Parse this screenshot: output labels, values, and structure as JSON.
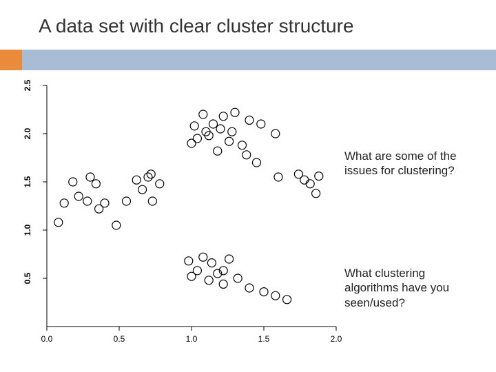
{
  "title": "A data set with clear cluster structure",
  "accent": {
    "left": "#e98b3a",
    "right": "#a9bcd6"
  },
  "callouts": {
    "q1": "What are some of the issues for clustering?",
    "q2": "What clustering algorithms have you seen/used?"
  },
  "chart_data": {
    "type": "scatter",
    "title": "",
    "xlabel": "",
    "ylabel": "",
    "xlim": [
      0.0,
      2.0
    ],
    "ylim": [
      0.0,
      2.5
    ],
    "xticks": [
      0.0,
      0.5,
      1.0,
      1.5,
      2.0
    ],
    "yticks": [
      0.5,
      1.0,
      1.5,
      2.0,
      2.5
    ],
    "series": [
      {
        "name": "points",
        "marker": "open-circle",
        "x": [
          0.08,
          0.12,
          0.18,
          0.22,
          0.28,
          0.3,
          0.34,
          0.36,
          0.4,
          0.48,
          0.55,
          0.62,
          0.66,
          0.7,
          0.72,
          0.73,
          0.78,
          1.0,
          1.02,
          1.04,
          1.08,
          1.1,
          1.12,
          1.15,
          1.18,
          1.2,
          1.22,
          1.26,
          1.28,
          1.3,
          1.35,
          1.38,
          1.4,
          1.45,
          1.48,
          1.58,
          0.98,
          1.0,
          1.04,
          1.08,
          1.12,
          1.14,
          1.18,
          1.22,
          1.22,
          1.26,
          1.32,
          1.4,
          1.5,
          1.58,
          1.66,
          1.74,
          1.78,
          1.82,
          1.86,
          1.88,
          1.6
        ],
        "y": [
          1.08,
          1.28,
          1.5,
          1.35,
          1.3,
          1.55,
          1.48,
          1.22,
          1.28,
          1.05,
          1.3,
          1.52,
          1.42,
          1.55,
          1.58,
          1.3,
          1.48,
          1.9,
          2.08,
          1.95,
          2.2,
          2.02,
          1.98,
          2.1,
          1.82,
          2.05,
          2.18,
          1.92,
          2.02,
          2.22,
          1.88,
          1.78,
          2.14,
          1.7,
          2.1,
          2.0,
          0.68,
          0.52,
          0.58,
          0.72,
          0.48,
          0.66,
          0.55,
          0.44,
          0.58,
          0.7,
          0.5,
          0.4,
          0.36,
          0.32,
          0.28,
          1.58,
          1.52,
          1.48,
          1.38,
          1.56,
          1.55
        ]
      }
    ]
  }
}
